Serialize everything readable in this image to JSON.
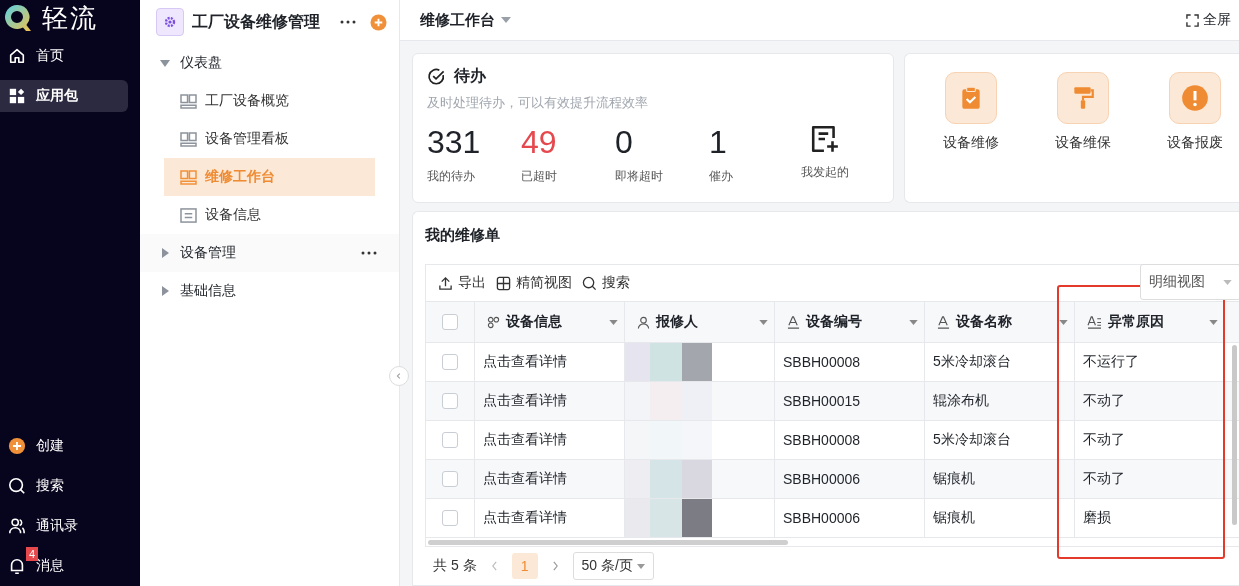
{
  "app": {
    "logo_text": "轻流"
  },
  "nav": [
    {
      "label": "首页",
      "kind": "home",
      "selected": false
    },
    {
      "label": "应用包",
      "kind": "apps",
      "selected": true
    }
  ],
  "nav_bottom": [
    {
      "label": "创建",
      "kind": "plus"
    },
    {
      "label": "搜索",
      "kind": "search"
    },
    {
      "label": "通讯录",
      "kind": "contacts"
    },
    {
      "label": "消息",
      "kind": "bell",
      "badge": "4"
    }
  ],
  "package": {
    "title": "工厂设备维修管理"
  },
  "tree": [
    {
      "label": "仪表盘",
      "expanded": true,
      "hovered": false,
      "children": [
        {
          "label": "工厂设备概览",
          "kind": "dashboard",
          "selected": false
        },
        {
          "label": "设备管理看板",
          "kind": "dashboard",
          "selected": false
        },
        {
          "label": "维修工作台",
          "kind": "dashboard",
          "selected": true
        },
        {
          "label": "设备信息",
          "kind": "form",
          "selected": false
        }
      ]
    },
    {
      "label": "设备管理",
      "expanded": false,
      "hovered": true
    },
    {
      "label": "基础信息",
      "expanded": false,
      "hovered": false
    }
  ],
  "page": {
    "title": "维修工作台",
    "fullscreen": "全屏"
  },
  "todo": {
    "title": "待办",
    "subtitle": "及时处理待办，可以有效提升流程效率",
    "stats": [
      {
        "value": "331",
        "label": "我的待办",
        "overdue": false
      },
      {
        "value": "49",
        "label": "已超时",
        "overdue": true
      },
      {
        "value": "0",
        "label": "即将超时",
        "overdue": false
      },
      {
        "value": "1",
        "label": "催办",
        "overdue": false
      }
    ],
    "launched": {
      "label": "我发起的"
    }
  },
  "shortcuts": [
    {
      "label": "设备维修",
      "kind": "clipboard"
    },
    {
      "label": "设备维保",
      "kind": "roller"
    },
    {
      "label": "设备报废",
      "kind": "alert"
    }
  ],
  "table": {
    "title": "我的维修单",
    "toolbar": [
      {
        "label": "导出",
        "kind": "export"
      },
      {
        "label": "精简视图",
        "kind": "grid"
      },
      {
        "label": "搜索",
        "kind": "search"
      }
    ],
    "view": "明细视图",
    "all_checked": false,
    "columns": [
      {
        "label": "设备信息",
        "kind": "relation"
      },
      {
        "label": "报修人",
        "kind": "user"
      },
      {
        "label": "设备编号",
        "kind": "text"
      },
      {
        "label": "设备名称",
        "kind": "text"
      },
      {
        "label": "异常原因",
        "kind": "multiline"
      }
    ],
    "rows": [
      {
        "checked": false,
        "info": "点击查看详情",
        "code": "SBBH00008",
        "name": "5米冷却滚台",
        "reason": "不运行了"
      },
      {
        "checked": false,
        "info": "点击查看详情",
        "code": "SBBH00015",
        "name": "辊涂布机",
        "reason": "不动了"
      },
      {
        "checked": false,
        "info": "点击查看详情",
        "code": "SBBH00008",
        "name": "5米冷却滚台",
        "reason": "不动了"
      },
      {
        "checked": false,
        "info": "点击查看详情",
        "code": "SBBH00006",
        "name": "锯痕机",
        "reason": "不动了"
      },
      {
        "checked": false,
        "info": "点击查看详情",
        "code": "SBBH00006",
        "name": "锯痕机",
        "reason": "磨损"
      }
    ],
    "pagination": {
      "total": "共 5 条",
      "pages": [
        {
          "label": "1",
          "selected": true
        }
      ],
      "page_size": "50 条/页"
    }
  }
}
